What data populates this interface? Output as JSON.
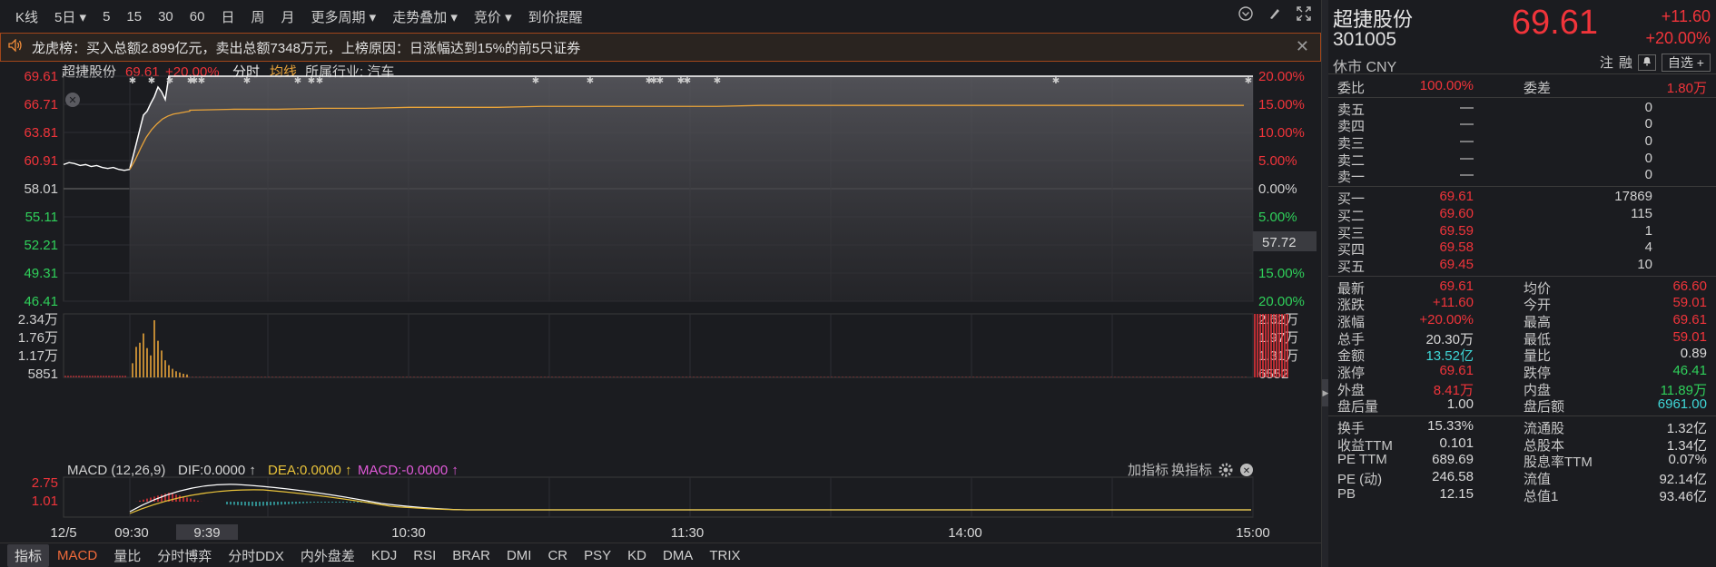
{
  "toolbar": {
    "items": [
      "K线",
      "5日 ▾",
      "5",
      "15",
      "30",
      "60",
      "日",
      "周",
      "月",
      "更多周期 ▾",
      "走势叠加 ▾",
      "竞价 ▾",
      "到价提醒"
    ],
    "icons": [
      "chevron-circle-icon",
      "brush-icon",
      "expand-icon"
    ]
  },
  "announce": {
    "text": "龙虎榜：买入总额2.899亿元，卖出总额7348万元，上榜原因：日涨幅达到15%的前5只证券"
  },
  "chart_header": {
    "name": "超捷股份",
    "price": "69.61",
    "pct": "+20.00%",
    "mode": "分时",
    "avg": "均线",
    "industry": "所属行业: 汽车"
  },
  "chart_data": {
    "type": "line",
    "price_ticks": [
      "69.61",
      "66.71",
      "63.81",
      "60.91",
      "58.01",
      "55.11",
      "52.21",
      "49.31",
      "46.41"
    ],
    "pct_ticks": [
      "20.00%",
      "15.00%",
      "10.00%",
      "5.00%",
      "0.00%",
      "5.00%",
      "10.00%",
      "15.00%",
      "20.00%"
    ],
    "prev_close": 58.01,
    "current_price_label": "57.72",
    "ylim": [
      46.41,
      69.61
    ],
    "volume_left_ticks": [
      "2.34万",
      "1.76万",
      "1.17万",
      "5851"
    ],
    "volume_right_ticks": [
      "2.62万",
      "1.97万",
      "1.31万",
      "6552"
    ],
    "macd_label": "MACD (12,26,9)",
    "dif_label": "DIF:0.0000 ↑",
    "dea_label": "DEA:0.0000 ↑",
    "macd_value_label": "MACD:-0.0000 ↑",
    "macd_ticks": [
      "2.75",
      "1.01"
    ],
    "indicator_buttons": [
      "加指标",
      "换指标"
    ],
    "x_labels": [
      "12/5",
      "09:30",
      "9:39",
      "10:30",
      "11:30",
      "14:00",
      "15:00"
    ],
    "prev_day_prices": [
      60.5,
      60.7,
      60.6,
      60.4,
      60.5,
      60.3,
      60.4,
      60.2,
      60.1,
      60.2,
      60.0,
      59.9,
      60.0
    ],
    "today_prices": [
      60.1,
      61.5,
      63.0,
      64.5,
      65.6,
      66.0,
      66.8,
      67.5,
      68.5,
      68.0,
      67.2,
      69.61,
      69.61
    ],
    "avg_prices": [
      60.0,
      61.0,
      62.2,
      63.3,
      64.1,
      64.7,
      65.2,
      65.5,
      65.7,
      65.8,
      65.9,
      66.0,
      66.1,
      66.2,
      66.2,
      66.3,
      66.3,
      66.4,
      66.4,
      66.4,
      66.5,
      66.5,
      66.5,
      66.5,
      66.5,
      66.6,
      66.6,
      66.6,
      66.6,
      66.6,
      66.6,
      66.6,
      66.6,
      66.6,
      66.6,
      66.6,
      66.6
    ],
    "volume_bars": [
      5800,
      12500,
      14200,
      18000,
      12000,
      9000,
      23400,
      15000,
      11000,
      7000,
      5000,
      3500,
      2500,
      2000,
      1500,
      1200
    ],
    "close_volume": 26000
  },
  "tabs": [
    "指标",
    "MACD",
    "量比",
    "分时博弈",
    "分时DDX",
    "内外盘差",
    "KDJ",
    "RSI",
    "BRAR",
    "DMI",
    "CR",
    "PSY",
    "KD",
    "DMA",
    "TRIX"
  ],
  "stock": {
    "name": "超捷股份",
    "code": "301005",
    "status": "休市 CNY",
    "price": "69.61",
    "change": "+11.60",
    "pct": "+20.00%",
    "actions": [
      "注",
      "融"
    ],
    "watch": "自选 +"
  },
  "order_book": {
    "weibi_label": "委比",
    "weibi": "100.00%",
    "weicha_label": "委差",
    "weicha": "1.80万",
    "sells": [
      {
        "label": "卖五",
        "price": "—",
        "vol": "0"
      },
      {
        "label": "卖四",
        "price": "—",
        "vol": "0"
      },
      {
        "label": "卖三",
        "price": "—",
        "vol": "0"
      },
      {
        "label": "卖二",
        "price": "—",
        "vol": "0"
      },
      {
        "label": "卖一",
        "price": "—",
        "vol": "0"
      }
    ],
    "buys": [
      {
        "label": "买一",
        "price": "69.61",
        "vol": "17869"
      },
      {
        "label": "买二",
        "price": "69.60",
        "vol": "115"
      },
      {
        "label": "买三",
        "price": "69.59",
        "vol": "1"
      },
      {
        "label": "买四",
        "price": "69.58",
        "vol": "4"
      },
      {
        "label": "买五",
        "price": "69.45",
        "vol": "10"
      }
    ]
  },
  "quote_stats": [
    {
      "l1": "最新",
      "v1": "69.61",
      "c1": "red",
      "l2": "均价",
      "v2": "66.60",
      "c2": "red"
    },
    {
      "l1": "涨跌",
      "v1": "+11.60",
      "c1": "red",
      "l2": "今开",
      "v2": "59.01",
      "c2": "red"
    },
    {
      "l1": "涨幅",
      "v1": "+20.00%",
      "c1": "red",
      "l2": "最高",
      "v2": "69.61",
      "c2": "red"
    },
    {
      "l1": "总手",
      "v1": "20.30万",
      "c1": "white",
      "l2": "最低",
      "v2": "59.01",
      "c2": "red"
    },
    {
      "l1": "金额",
      "v1": "13.52亿",
      "c1": "cyan",
      "l2": "量比",
      "v2": "0.89",
      "c2": "white"
    },
    {
      "l1": "涨停",
      "v1": "69.61",
      "c1": "red",
      "l2": "跌停",
      "v2": "46.41",
      "c2": "green"
    },
    {
      "l1": "外盘",
      "v1": "8.41万",
      "c1": "red",
      "l2": "内盘",
      "v2": "11.89万",
      "c2": "green"
    },
    {
      "l1": "盘后量",
      "v1": "1.00",
      "c1": "white",
      "l2": "盘后额",
      "v2": "6961.00",
      "c2": "cyan"
    }
  ],
  "fundamentals": [
    {
      "l1": "换手",
      "v1": "15.33%",
      "l2": "流通股",
      "v2": "1.32亿"
    },
    {
      "l1": "收益TTM",
      "v1": "0.101",
      "l2": "总股本",
      "v2": "1.34亿"
    },
    {
      "l1": "PE TTM",
      "v1": "689.69",
      "l2": "股息率TTM",
      "v2": "0.07%"
    },
    {
      "l1": "PE (动)",
      "v1": "246.58",
      "l2": "流值",
      "v2": "92.14亿"
    },
    {
      "l1": "PB",
      "v1": "12.15",
      "l2": "总值1",
      "v2": "93.46亿"
    }
  ],
  "colors": {
    "up": "#f0343a",
    "down": "#2fd05a",
    "price_line": "#ffffff",
    "avg_line": "#e8a33a",
    "accent": "#f06a3a"
  }
}
